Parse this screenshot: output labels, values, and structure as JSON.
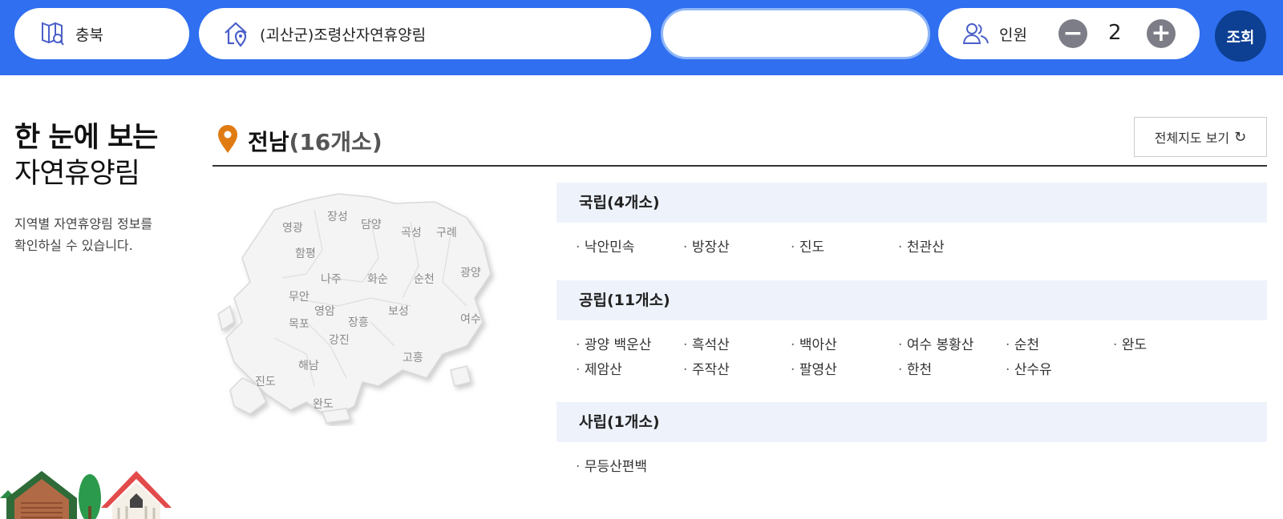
{
  "search": {
    "region_label": "충북",
    "forest_label": "(괴산군)조령산자연휴양림",
    "date_value": "",
    "people_label": "인원",
    "people_count": "2",
    "minus_label": "−",
    "plus_label": "+",
    "search_label": "조회"
  },
  "intro": {
    "title_line1": "한 눈에 보는",
    "title_line2": "자연휴양림",
    "description": "지역별 자연휴양림 정보를 확인하실 수 있습니다."
  },
  "region": {
    "name": "전남",
    "count": "(16개소)",
    "map_all_label": "전체지도 보기",
    "refresh_icon": "↻"
  },
  "map": {
    "labels": [
      "영광",
      "장성",
      "담양",
      "곡성",
      "구례",
      "함평",
      "나주",
      "화순",
      "순천",
      "광양",
      "무안",
      "영암",
      "보성",
      "목포",
      "장흥",
      "여수",
      "강진",
      "고흥",
      "해남",
      "진도",
      "완도"
    ]
  },
  "categories": {
    "national": {
      "title": "국립(4개소)",
      "items": [
        "낙안민속",
        "방장산",
        "진도",
        "천관산"
      ]
    },
    "public": {
      "title": "공립(11개소)",
      "items": [
        "광양 백운산",
        "흑석산",
        "백아산",
        "여수 봉황산",
        "순천",
        "완도",
        "제암산",
        "주작산",
        "팔영산",
        "한천",
        "산수유"
      ]
    },
    "private": {
      "title": "사립(1개소)",
      "items": [
        "무등산편백"
      ]
    }
  },
  "colors": {
    "topbar": "#2f6ff0",
    "search_button": "#0d3f93",
    "stepper": "#7c7d86",
    "pin": "#e07b12",
    "category_bg": "#eef3fb"
  }
}
